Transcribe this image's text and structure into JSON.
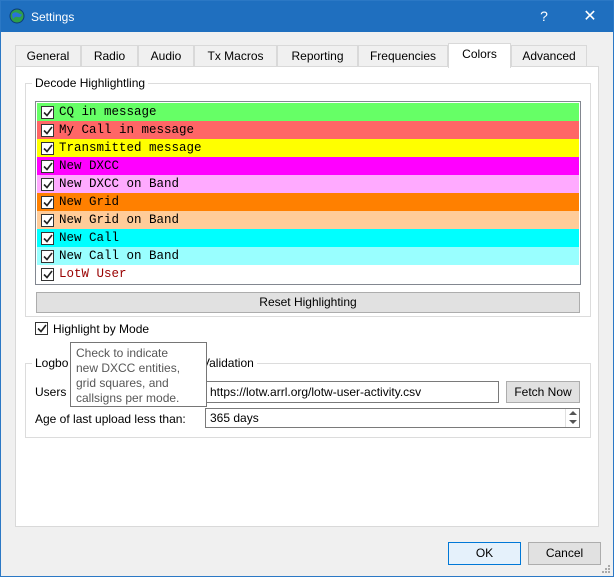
{
  "window": {
    "title": "Settings",
    "help_label": "?",
    "close_label": "✕"
  },
  "tabs": [
    {
      "label": "General",
      "active": false
    },
    {
      "label": "Radio",
      "active": false
    },
    {
      "label": "Audio",
      "active": false
    },
    {
      "label": "Tx Macros",
      "active": false
    },
    {
      "label": "Reporting",
      "active": false
    },
    {
      "label": "Frequencies",
      "active": false
    },
    {
      "label": "Colors",
      "active": true
    },
    {
      "label": "Advanced",
      "active": false
    }
  ],
  "decode_highlighting": {
    "title": "Decode Highlightling",
    "items": [
      {
        "label": "CQ in message",
        "checked": true,
        "bg": "#66ff66",
        "fg": "#000000"
      },
      {
        "label": "My Call in message",
        "checked": true,
        "bg": "#ff6666",
        "fg": "#000000"
      },
      {
        "label": "Transmitted message",
        "checked": true,
        "bg": "#ffff00",
        "fg": "#000000"
      },
      {
        "label": "New DXCC",
        "checked": true,
        "bg": "#ff00ff",
        "fg": "#000000"
      },
      {
        "label": "New DXCC on Band",
        "checked": true,
        "bg": "#ffaaff",
        "fg": "#000000"
      },
      {
        "label": "New Grid",
        "checked": true,
        "bg": "#ff8000",
        "fg": "#000000"
      },
      {
        "label": "New Grid on Band",
        "checked": true,
        "bg": "#ffcc99",
        "fg": "#000000"
      },
      {
        "label": "New Call",
        "checked": true,
        "bg": "#00ffff",
        "fg": "#000000"
      },
      {
        "label": "New Call on Band",
        "checked": true,
        "bg": "#99ffff",
        "fg": "#000000"
      },
      {
        "label": "LotW User",
        "checked": true,
        "bg": "#ffffff",
        "fg": "#990000"
      }
    ],
    "reset_label": "Reset Highlighting",
    "highlight_by_mode_label": "Highlight by Mode",
    "highlight_by_mode_checked": true
  },
  "tooltip": {
    "lines": [
      "Check to indicate",
      "new DXCC entities,",
      "grid squares, and",
      "callsigns per mode."
    ]
  },
  "lotw": {
    "title_left": "Logbo",
    "title_right": "Validation",
    "users_label": "Users",
    "url_value": "https://lotw.arrl.org/lotw-user-activity.csv",
    "fetch_label": "Fetch Now",
    "age_label": "Age of last upload less than:",
    "age_value": "365 days"
  },
  "footer": {
    "ok_label": "OK",
    "cancel_label": "Cancel"
  },
  "colors": {
    "titlebar": "#1f6fbf",
    "accent": "#0078d7"
  }
}
